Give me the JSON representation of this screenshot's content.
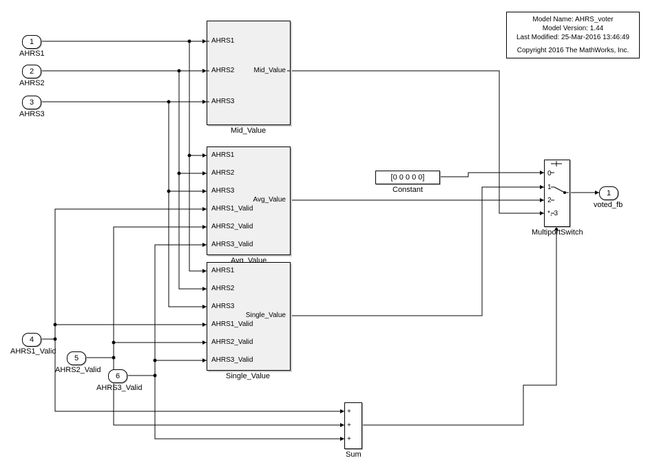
{
  "inports": {
    "p1": {
      "num": "1",
      "label": "AHRS1"
    },
    "p2": {
      "num": "2",
      "label": "AHRS2"
    },
    "p3": {
      "num": "3",
      "label": "AHRS3"
    },
    "p4": {
      "num": "4",
      "label": "AHRS1_Valid"
    },
    "p5": {
      "num": "5",
      "label": "AHRS2_Valid"
    },
    "p6": {
      "num": "6",
      "label": "AHRS3_Valid"
    }
  },
  "outports": {
    "o1": {
      "num": "1",
      "label": "voted_fb"
    }
  },
  "blocks": {
    "mid": {
      "name": "Mid_Value",
      "inports": [
        "AHRS1",
        "AHRS2",
        "AHRS3"
      ],
      "outport": "Mid_Value"
    },
    "avg": {
      "name": "Avg_Value",
      "inports": [
        "AHRS1",
        "AHRS2",
        "AHRS3",
        "AHRS1_Valid",
        "AHRS2_Valid",
        "AHRS3_Valid"
      ],
      "outport": "Avg_Value"
    },
    "single": {
      "name": "Single_Value",
      "inports": [
        "AHRS1",
        "AHRS2",
        "AHRS3",
        "AHRS1_Valid",
        "AHRS2_Valid",
        "AHRS3_Valid"
      ],
      "outport": "Single_Value"
    },
    "constant": {
      "name": "Constant",
      "value": "[0    0    0    0    0]"
    },
    "switch": {
      "name": "MultiportSwitch",
      "labels": {
        "p0": "0",
        "p1": "1",
        "p2": "2",
        "p3": "*, 3"
      }
    },
    "sum": {
      "name": "Sum",
      "ops": [
        "+",
        "+",
        "+"
      ]
    }
  },
  "info": {
    "l1": "Model Name: AHRS_voter",
    "l2": "Model Version: 1.44",
    "l3": "Last Modified: 25-Mar-2016 13:46:49",
    "l4": "Copyright 2016 The MathWorks, Inc."
  }
}
